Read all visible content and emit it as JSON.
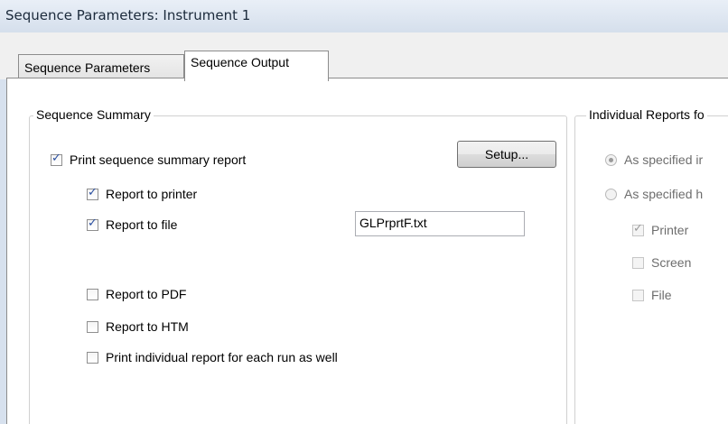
{
  "window": {
    "title": "Sequence Parameters: Instrument 1"
  },
  "tabs": [
    {
      "label": "Sequence Parameters",
      "active": false
    },
    {
      "label": "Sequence Output",
      "active": true
    }
  ],
  "sequence_summary": {
    "group_label": "Sequence Summary",
    "print_summary": {
      "label": "Print sequence summary report",
      "checked": true
    },
    "setup_button": "Setup...",
    "report_to_printer": {
      "label": "Report to printer",
      "checked": true
    },
    "report_to_file": {
      "label": "Report to file",
      "checked": true,
      "filename": "GLPrprtF.txt"
    },
    "report_to_pdf": {
      "label": "Report to PDF",
      "checked": false
    },
    "report_to_htm": {
      "label": "Report to HTM",
      "checked": false
    },
    "print_individual": {
      "label": "Print individual report for each run as well",
      "checked": false
    }
  },
  "individual_reports": {
    "group_label": "Individual Reports fo",
    "option_specified_in": {
      "label": "As specified ir",
      "selected": true
    },
    "option_specified_here": {
      "label": "As specified h",
      "selected": false
    },
    "printer": {
      "label": "Printer",
      "checked": true
    },
    "screen": {
      "label": "Screen",
      "checked": false
    },
    "file": {
      "label": "File",
      "checked": false
    }
  },
  "colors": {
    "accent": "#2a4fa0",
    "titlebar": "#d7e1ee",
    "tab_bg": "#f0f0f0"
  }
}
